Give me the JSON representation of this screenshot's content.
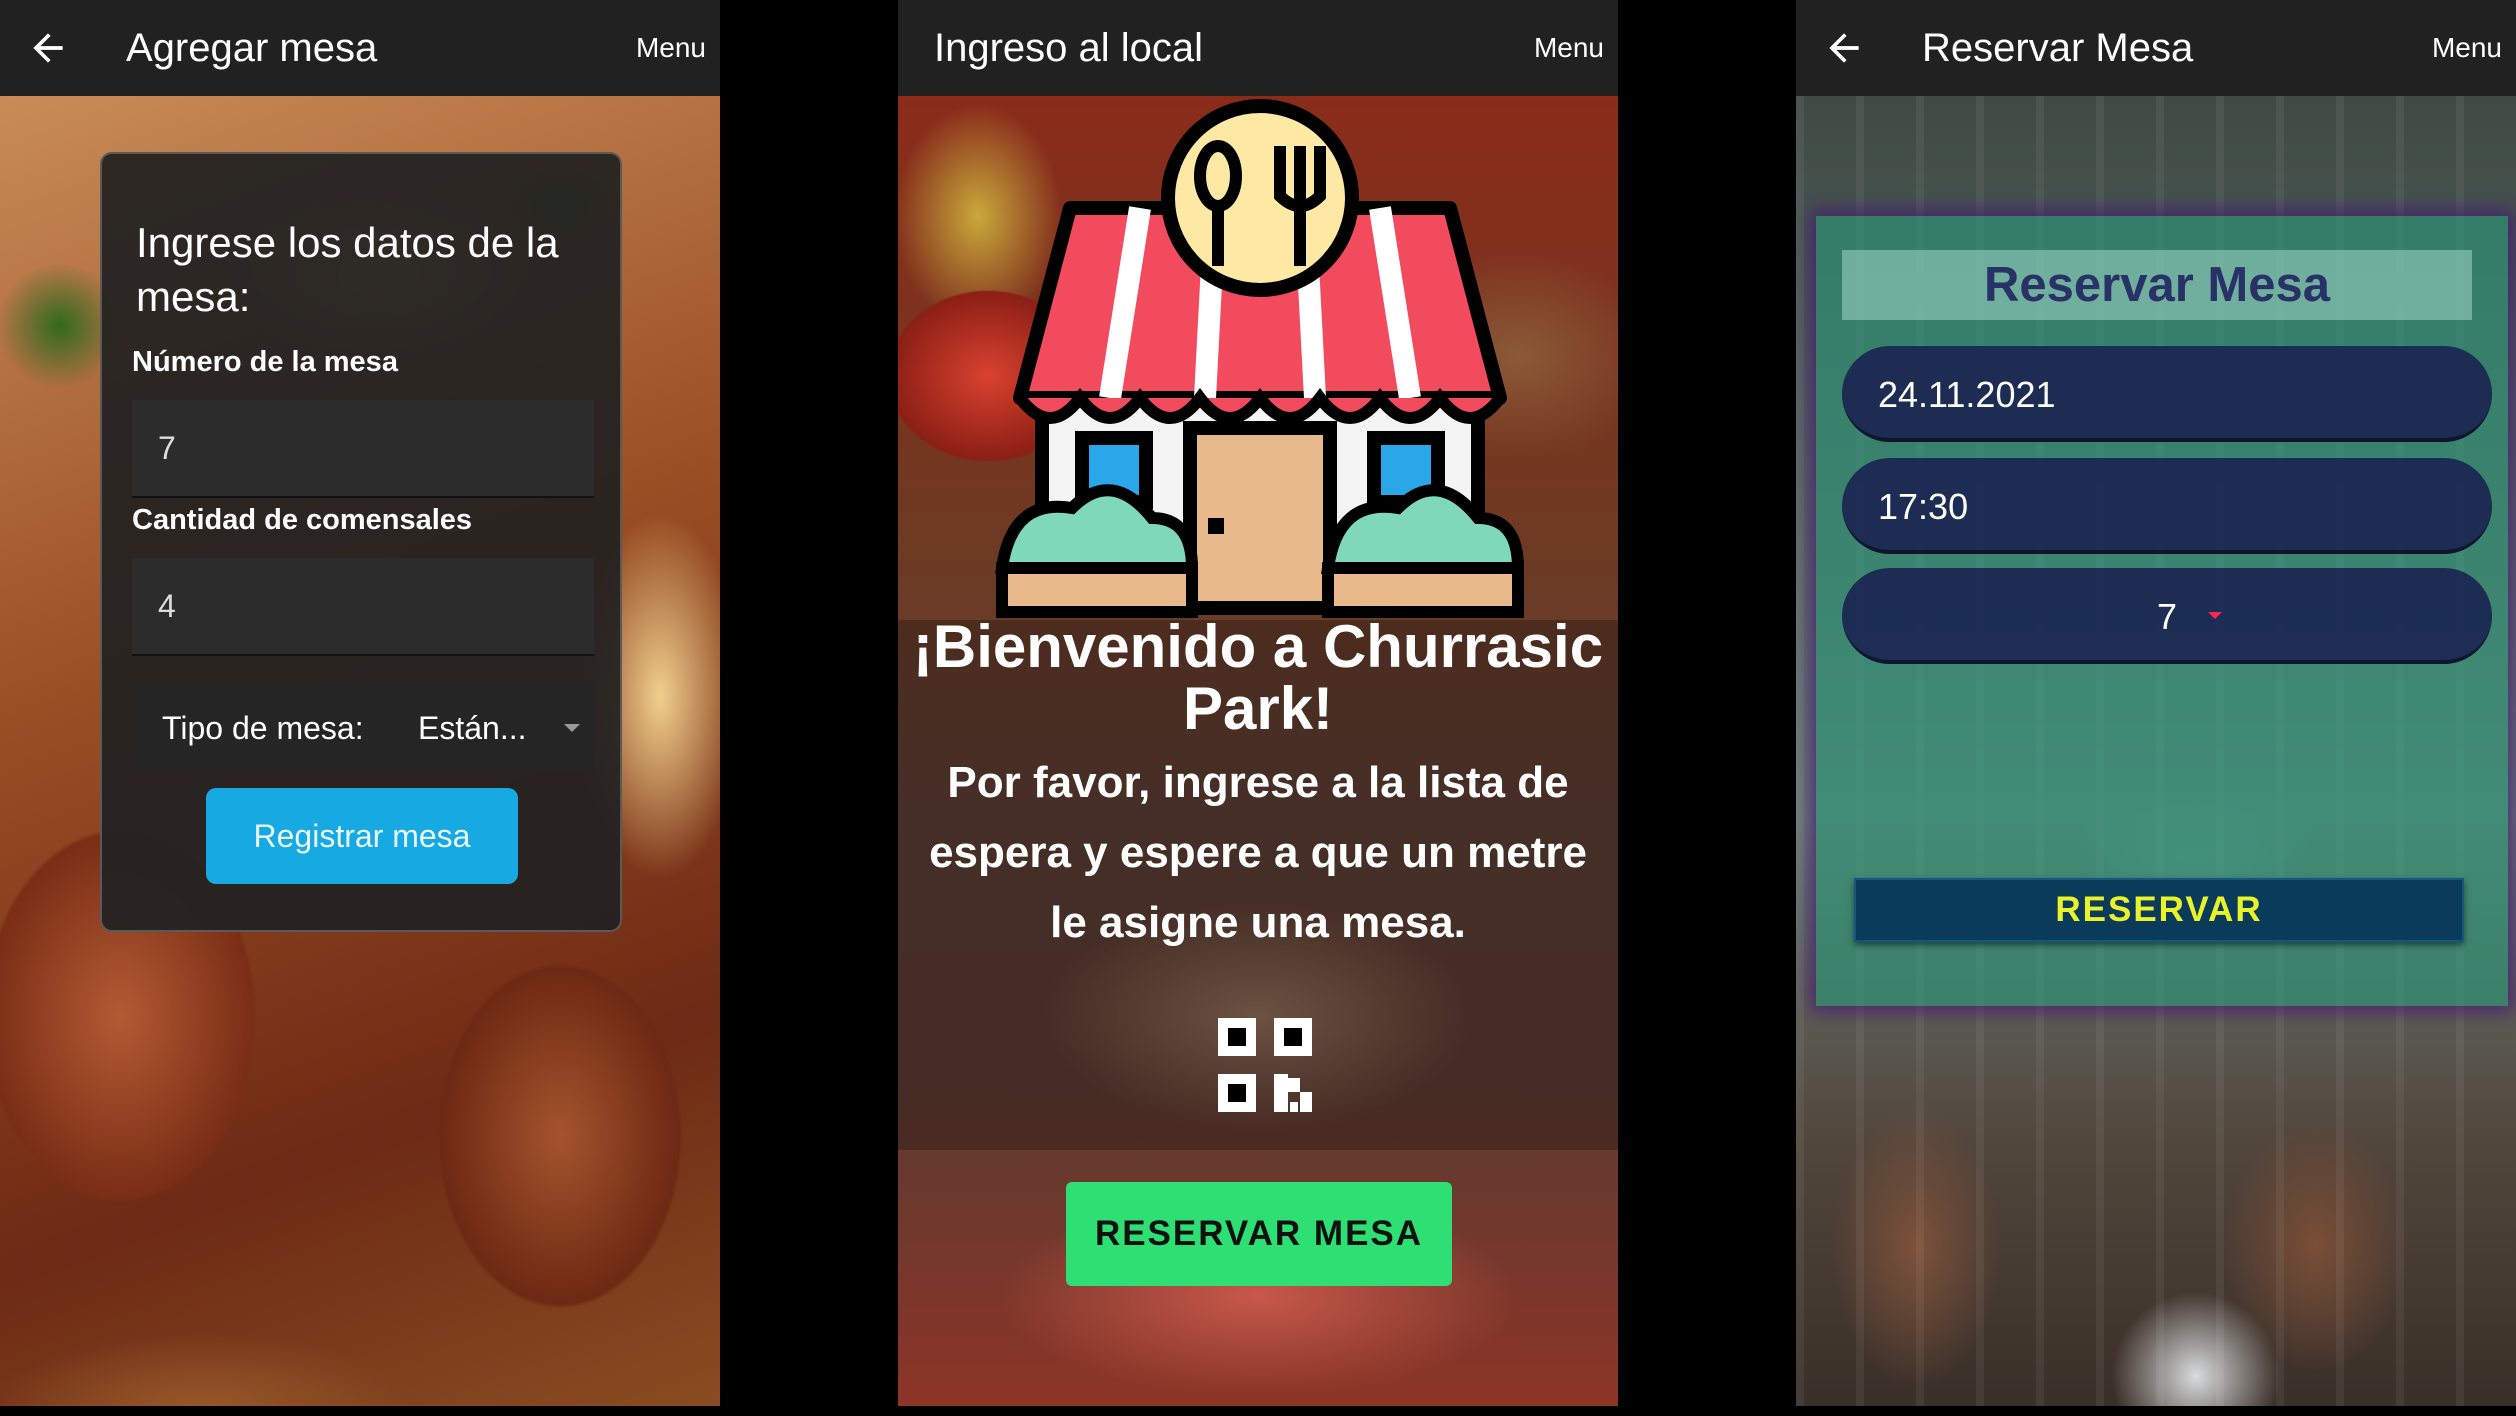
{
  "screens": {
    "agregar_mesa": {
      "title": "Agregar mesa",
      "menu": "Menu",
      "card": {
        "heading": "Ingrese los datos de la mesa:",
        "numero_label": "Número de la mesa",
        "numero_value": "7",
        "comensales_label": "Cantidad de comensales",
        "comensales_value": "4",
        "tipo_label": "Tipo de mesa:",
        "tipo_value": "Están...",
        "register_button": "Registrar mesa"
      }
    },
    "ingreso_local": {
      "title": "Ingreso al local",
      "menu": "Menu",
      "welcome": "¡Bienvenido a Churrasic Park!",
      "message": "Por favor, ingrese a la lista de espera y espere a que un metre le asigne una mesa.",
      "reserve_button": "RESERVAR MESA"
    },
    "reservar_mesa": {
      "title": "Reservar Mesa",
      "menu": "Menu",
      "panel_title": "Reservar Mesa",
      "date": "24.11.2021",
      "time": "17:30",
      "table_number": "7",
      "reserve_button": "RESERVAR"
    }
  },
  "colors": {
    "appbar": "#212121",
    "register_button": "#17a9e1",
    "reserve_mesa_button": "#2ee073",
    "reservar_button_text": "#e8f32a",
    "panel_title_text": "#283266"
  },
  "icons": [
    "arrow-left-icon",
    "restaurant-shop-icon",
    "qr-code-icon",
    "dropdown-caret-icon"
  ]
}
